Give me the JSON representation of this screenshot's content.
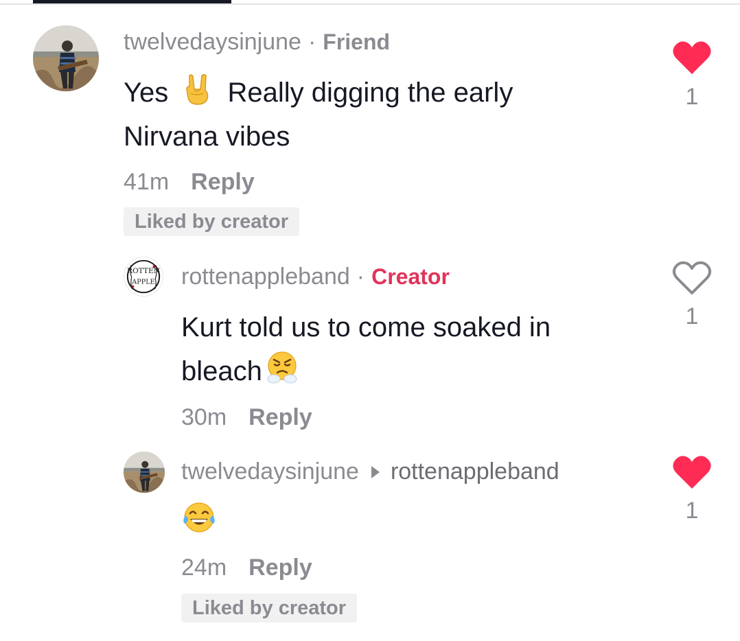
{
  "comments": [
    {
      "username": "twelvedaysinjune",
      "separator": "·",
      "tag": "Friend",
      "text_line1": "Yes",
      "text_line1b": "Really digging the early",
      "text_line2": "Nirvana vibes",
      "time": "41m",
      "reply_label": "Reply",
      "liked_badge": "Liked by creator",
      "like_count": "1",
      "liked": true
    },
    {
      "username": "rottenappleband",
      "separator": "·",
      "tag": "Creator",
      "text_line1": "Kurt told us to come soaked in",
      "text_line2": "bleach",
      "time": "30m",
      "reply_label": "Reply",
      "like_count": "1",
      "liked": false
    },
    {
      "username": "twelvedaysinjune",
      "reply_to": "rottenappleband",
      "time": "24m",
      "reply_label": "Reply",
      "liked_badge": "Liked by creator",
      "like_count": "1",
      "liked": true
    }
  ],
  "avatar_logo_text": "ROTTEN APPLE",
  "colors": {
    "like_red": "#fe2c55",
    "creator_red": "#e0345a",
    "muted_gray": "#8a8b91"
  },
  "icons": {
    "liked": "heart-filled-icon",
    "unliked": "heart-outline-icon",
    "emojis": [
      "rock-on-hand-emoji",
      "steam-from-nose-emoji",
      "tears-of-joy-emoji"
    ]
  }
}
